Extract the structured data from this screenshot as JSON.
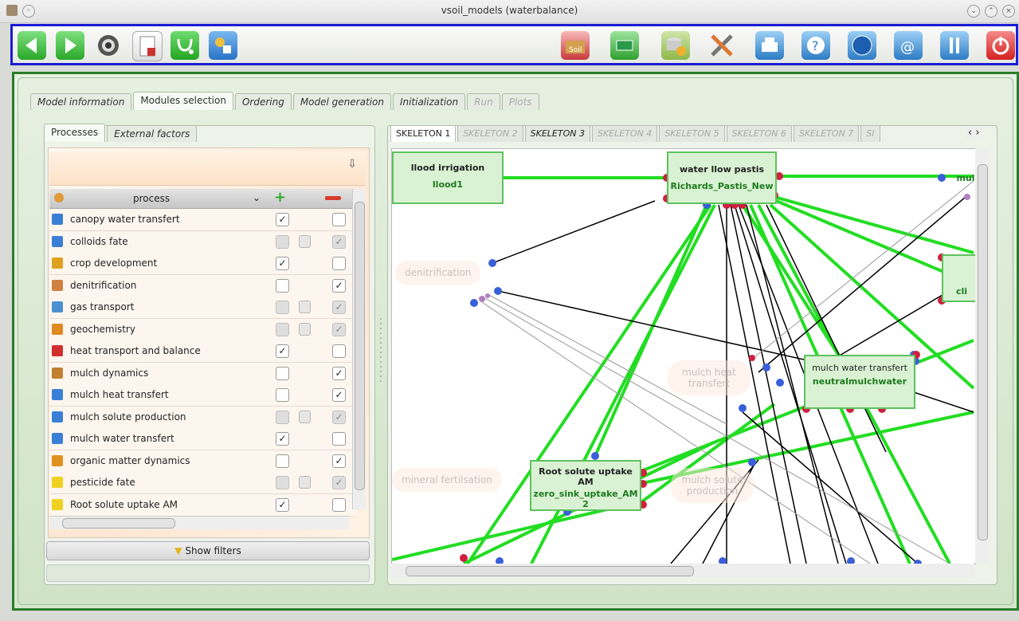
{
  "window": {
    "title": "vsoil_models (waterbalance)"
  },
  "main_tabs": [
    {
      "label": "Model information",
      "state": "normal"
    },
    {
      "label": "Modules selection",
      "state": "active"
    },
    {
      "label": "Ordering",
      "state": "normal"
    },
    {
      "label": "Model generation",
      "state": "normal"
    },
    {
      "label": "Initialization",
      "state": "normal"
    },
    {
      "label": "Run",
      "state": "disabled"
    },
    {
      "label": "Plots",
      "state": "disabled"
    }
  ],
  "left_tabs": {
    "processes": "Processes",
    "external": "External factors"
  },
  "table": {
    "header": "process",
    "rows": [
      {
        "label": "canopy water transfert",
        "c1": "✓",
        "locked": false,
        "c2": "",
        "c2dis": false,
        "icon": "#3a7fd6"
      },
      {
        "label": "colloids fate",
        "c1": "",
        "locked": true,
        "c2": "✓",
        "c2dis": true,
        "icon": "#3a7fd6"
      },
      {
        "label": "crop development",
        "c1": "✓",
        "locked": false,
        "c2": "",
        "c2dis": false,
        "icon": "#e0a020"
      },
      {
        "label": "denitrification",
        "c1": "",
        "locked": false,
        "c2": "✓",
        "c2dis": false,
        "icon": "#d08040"
      },
      {
        "label": "gas transport",
        "c1": "",
        "locked": true,
        "c2": "✓",
        "c2dis": true,
        "icon": "#4a90d0"
      },
      {
        "label": "geochemistry",
        "c1": "",
        "locked": true,
        "c2": "✓",
        "c2dis": true,
        "icon": "#e08a20"
      },
      {
        "label": "heat transport and balance",
        "c1": "✓",
        "locked": false,
        "c2": "",
        "c2dis": false,
        "icon": "#d03030"
      },
      {
        "label": "mulch dynamics",
        "c1": "",
        "locked": false,
        "c2": "✓",
        "c2dis": false,
        "icon": "#c08030"
      },
      {
        "label": "mulch heat transfert",
        "c1": "",
        "locked": false,
        "c2": "✓",
        "c2dis": false,
        "icon": "#3a7fd6"
      },
      {
        "label": "mulch solute production",
        "c1": "",
        "locked": true,
        "c2": "✓",
        "c2dis": true,
        "icon": "#3a7fd6"
      },
      {
        "label": "mulch water transfert",
        "c1": "✓",
        "locked": false,
        "c2": "",
        "c2dis": false,
        "icon": "#3a7fd6"
      },
      {
        "label": "organic matter dynamics",
        "c1": "",
        "locked": false,
        "c2": "✓",
        "c2dis": false,
        "icon": "#e09020"
      },
      {
        "label": "pesticide fate",
        "c1": "",
        "locked": true,
        "c2": "✓",
        "c2dis": true,
        "icon": "#f0d020"
      },
      {
        "label": "Root solute uptake AM",
        "c1": "✓",
        "locked": false,
        "c2": "",
        "c2dis": false,
        "icon": "#f0d020"
      }
    ]
  },
  "show_filters": "Show filters",
  "skeleton_tabs": [
    {
      "label": "SKELETON 1",
      "state": "active"
    },
    {
      "label": "SKELETON 2",
      "state": "disabled"
    },
    {
      "label": "SKELETON 3",
      "state": "bold"
    },
    {
      "label": "SKELETON 4",
      "state": "disabled"
    },
    {
      "label": "SKELETON 5",
      "state": "disabled"
    },
    {
      "label": "SKELETON 6",
      "state": "disabled"
    },
    {
      "label": "SKELETON 7",
      "state": "disabled"
    },
    {
      "label": "SI",
      "state": "disabled"
    }
  ],
  "graph": {
    "nodes": [
      {
        "name": "llood irrigation",
        "impl": "llood1"
      },
      {
        "name": "water llow pastis",
        "impl": "Richards_Pastis_New"
      },
      {
        "name": "mulch water transfert",
        "impl": "neutralmulchwater"
      },
      {
        "name": "Root solute uptake AM",
        "impl": "zero_sink_uptake_AM 2"
      },
      {
        "name": "mul",
        "impl": ""
      },
      {
        "name": "",
        "impl": "cli"
      }
    ],
    "ghosts": [
      "denitrification",
      "mulch heat transfert",
      "mineral fertilsation",
      "mulch solute production"
    ]
  },
  "colors": {
    "accent_blue": "#1b1bd6",
    "frame_green": "#2a7d2a",
    "link_green": "#22dd22",
    "node_fill": "#d9f2d3"
  }
}
